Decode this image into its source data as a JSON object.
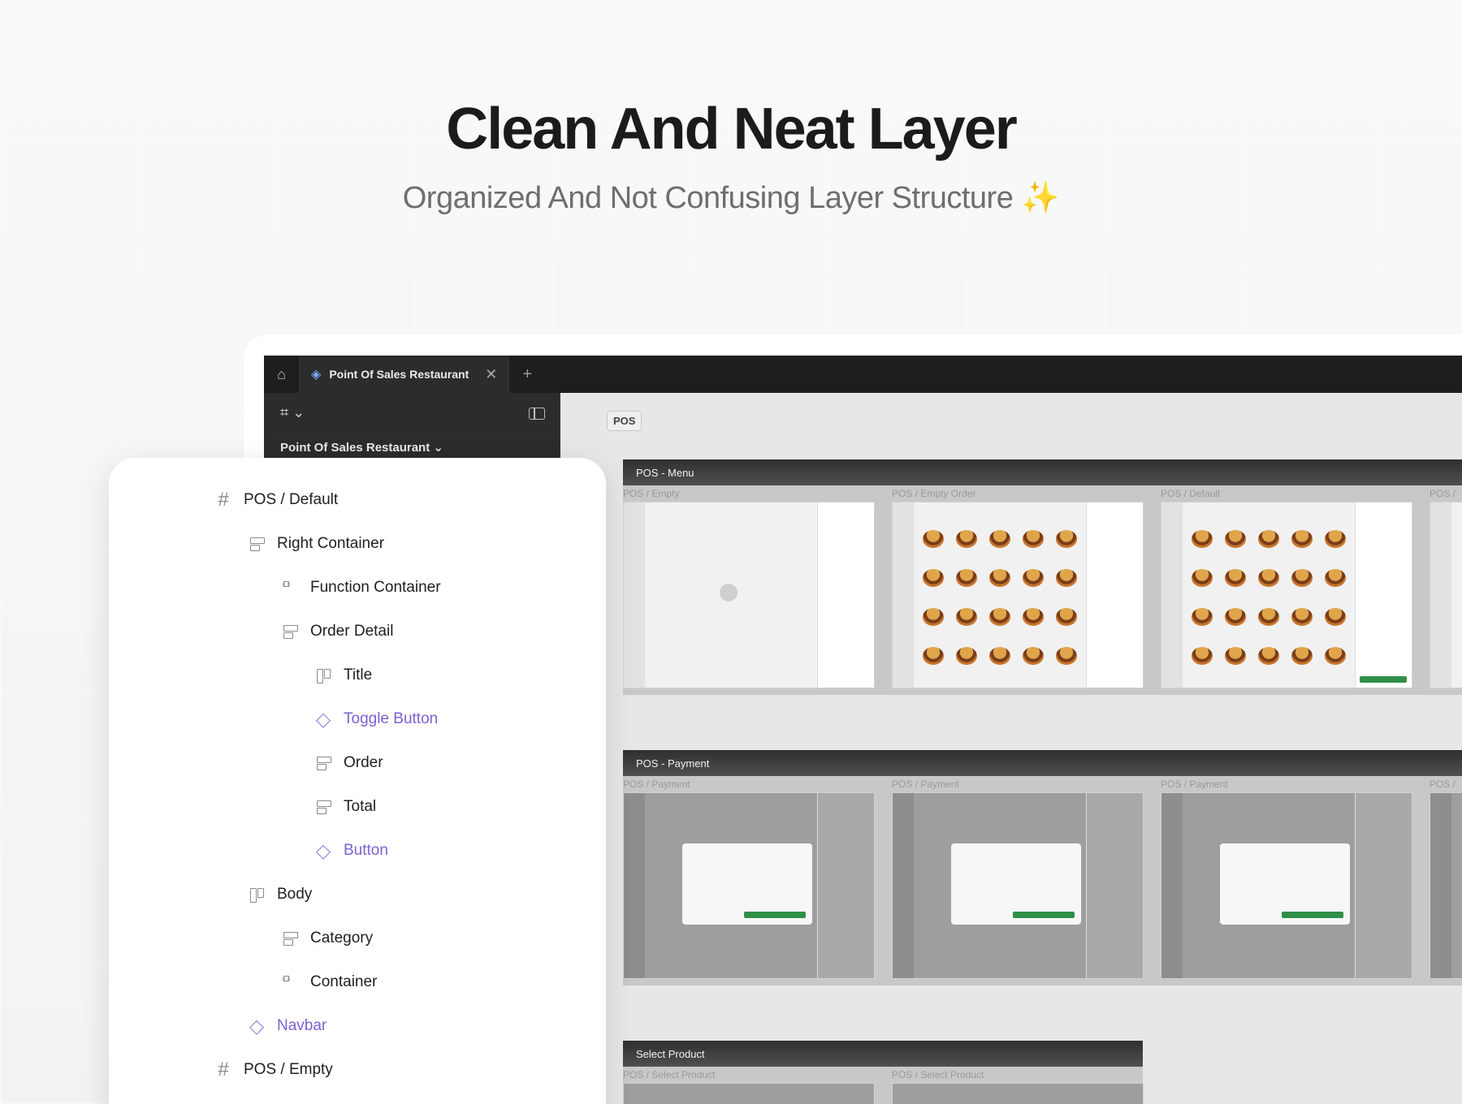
{
  "headline": "Clean And Neat Layer",
  "subline": "Organized And Not Confusing Layer Structure ✨",
  "app": {
    "tab_title": "Point Of Sales Restaurant",
    "tab_close": "✕",
    "tab_plus": "+",
    "project_name": "Point Of Sales Restaurant ⌄",
    "figma_menu": "⌗ ⌄"
  },
  "canvas": {
    "page_badge": "POS",
    "sections": [
      {
        "title": "POS - Menu",
        "frames": [
          "POS / Empty",
          "POS / Empty Order",
          "POS / Default",
          "POS /"
        ]
      },
      {
        "title": "POS - Payment",
        "frames": [
          "POS / Payment",
          "POS / Payment",
          "POS / Payment",
          "POS /"
        ]
      },
      {
        "title": "Select Product",
        "frames": [
          "POS / Select Product",
          "POS / Select Product"
        ]
      }
    ]
  },
  "layers": [
    {
      "label": "POS / Default",
      "icon": "frame-icon",
      "kind": "frame"
    },
    {
      "label": "Right Container",
      "icon": "horizontal-stack-icon",
      "kind": "stack"
    },
    {
      "label": "Function Container",
      "icon": "grid-layout-icon",
      "kind": "grid"
    },
    {
      "label": "Order Detail",
      "icon": "horizontal-stack-icon",
      "kind": "stack"
    },
    {
      "label": "Title",
      "icon": "vertical-stack-icon",
      "kind": "vstack"
    },
    {
      "label": "Toggle Button",
      "icon": "component-icon",
      "kind": "component"
    },
    {
      "label": "Order",
      "icon": "horizontal-stack-icon",
      "kind": "stack"
    },
    {
      "label": "Total",
      "icon": "horizontal-stack-icon",
      "kind": "stack"
    },
    {
      "label": "Button",
      "icon": "component-icon",
      "kind": "component"
    },
    {
      "label": "Body",
      "icon": "vertical-stack-icon",
      "kind": "vstack"
    },
    {
      "label": "Category",
      "icon": "horizontal-stack-icon",
      "kind": "stack"
    },
    {
      "label": "Container",
      "icon": "grid-layout-icon",
      "kind": "grid"
    },
    {
      "label": "Navbar",
      "icon": "component-icon",
      "kind": "component"
    },
    {
      "label": "POS / Empty",
      "icon": "frame-icon",
      "kind": "frame"
    }
  ]
}
